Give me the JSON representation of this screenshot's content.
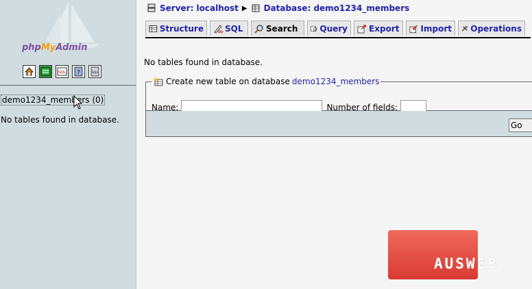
{
  "left": {
    "logo": {
      "php": "php",
      "my": "My",
      "admin": "Admin"
    },
    "icons": [
      "home-icon",
      "query-window-icon",
      "sql-icon",
      "documentation-icon",
      "sql-doc-icon"
    ],
    "database": "demo1234_members (0)",
    "no_tables": "No tables found in database."
  },
  "breadcrumb": {
    "server": "Server: localhost",
    "database": "Database: demo1234_members"
  },
  "tabs": [
    {
      "label": "Structure",
      "icon": "structure-icon"
    },
    {
      "label": "SQL",
      "icon": "sql-tab-icon"
    },
    {
      "label": "Search",
      "icon": "search-icon"
    },
    {
      "label": "Query",
      "icon": "query-icon"
    },
    {
      "label": "Export",
      "icon": "export-icon"
    },
    {
      "label": "Import",
      "icon": "import-icon"
    },
    {
      "label": "Operations",
      "icon": "operations-icon"
    }
  ],
  "main": {
    "no_tables": "No tables found in database.",
    "create": {
      "legend_prefix": "Create new table on database",
      "legend_db": "demo1234_members",
      "name_label": "Name:",
      "name_value": "",
      "fields_label": "Number of fields:",
      "fields_value": ""
    },
    "go_label": "Go"
  },
  "watermark": {
    "text": "AUSWEB",
    "color": "#e4483e"
  }
}
